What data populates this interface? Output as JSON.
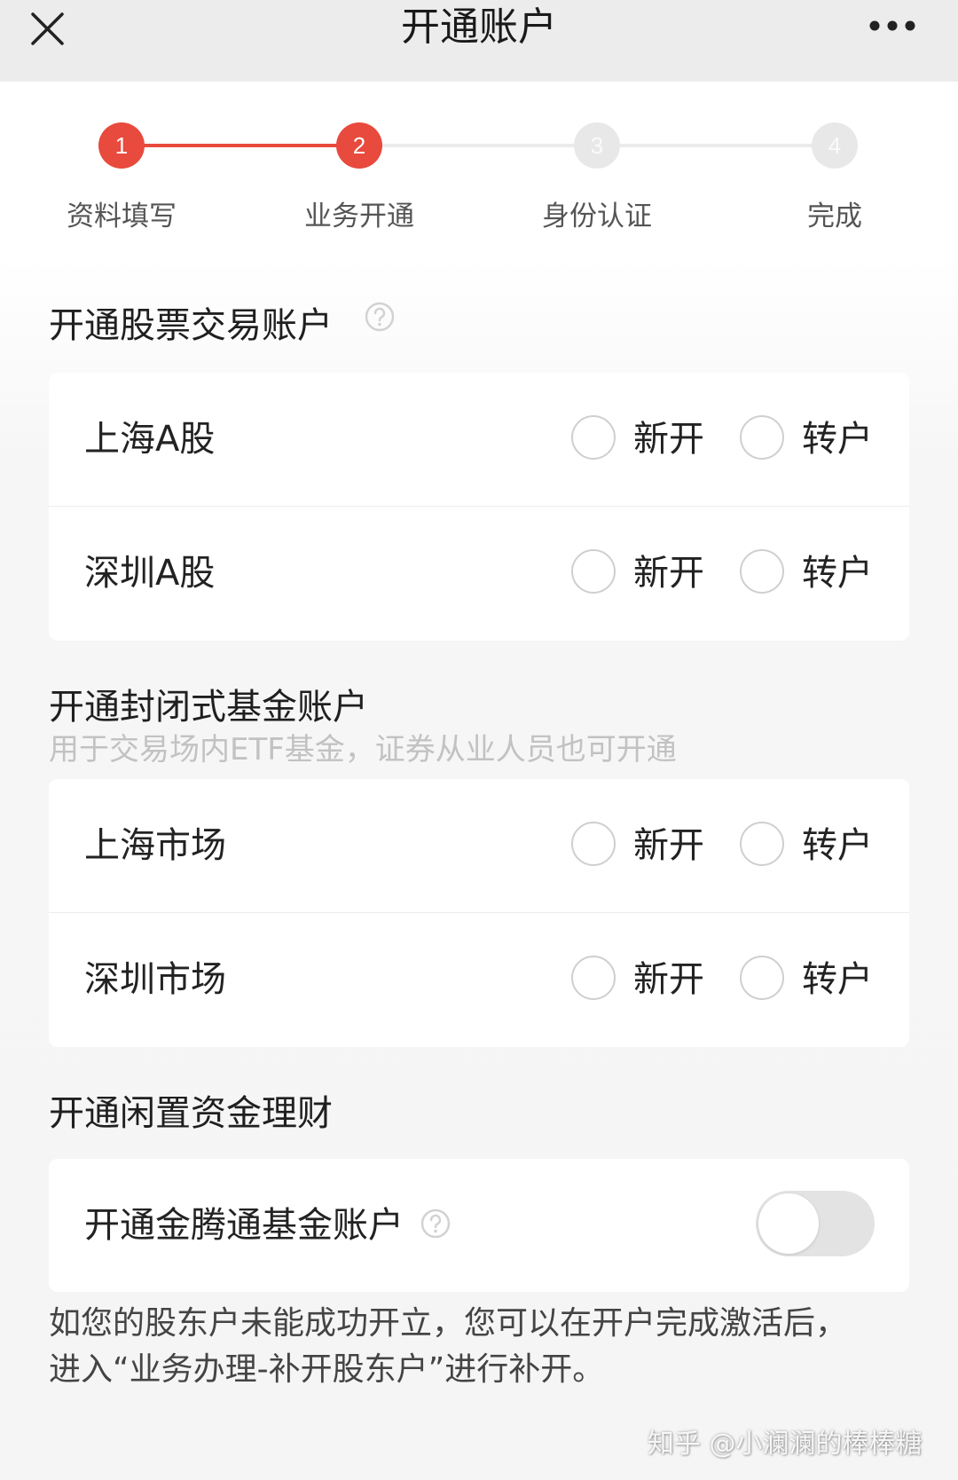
{
  "header": {
    "title": "开通账户"
  },
  "steps": [
    {
      "number": "1",
      "label": "资料填写",
      "status": "done"
    },
    {
      "number": "2",
      "label": "业务开通",
      "status": "current"
    },
    {
      "number": "3",
      "label": "身份认证",
      "status": "pending"
    },
    {
      "number": "4",
      "label": "完成",
      "status": "pending"
    }
  ],
  "stock_section": {
    "title": "开通股票交易账户",
    "rows": [
      {
        "label": "上海A股",
        "option_new": "新开",
        "option_transfer": "转户"
      },
      {
        "label": "深圳A股",
        "option_new": "新开",
        "option_transfer": "转户"
      }
    ]
  },
  "fund_section": {
    "title": "开通封闭式基金账户",
    "subtitle": "用于交易场内ETF基金，证券从业人员也可开通",
    "rows": [
      {
        "label": "上海市场",
        "option_new": "新开",
        "option_transfer": "转户"
      },
      {
        "label": "深圳市场",
        "option_new": "新开",
        "option_transfer": "转户"
      }
    ]
  },
  "idle_section": {
    "title": "开通闲置资金理财",
    "row_label": "开通金腾通基金账户",
    "toggle_on": false
  },
  "note": {
    "line1": "如您的股东户未能成功开立，您可以在开户完成激活后，",
    "line2": "进入“业务办理-补开股东户”进行补开。"
  },
  "watermark": "知乎 @小澜澜的棒棒糖",
  "colors": {
    "accent": "#e84a3d",
    "inactive_step": "#e8e8e8"
  }
}
